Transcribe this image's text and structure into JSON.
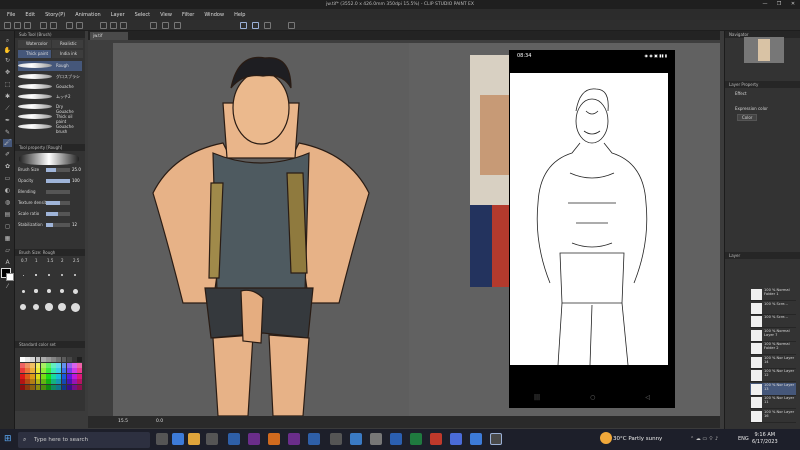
{
  "window": {
    "title": "jw.tif* (3552.0 x 426.0mm 350dpi 15.5%) - CLIP STUDIO PAINT EX",
    "minimize": "—",
    "maximize": "❐",
    "close": "✕"
  },
  "menu": [
    "File",
    "Edit",
    "Story(P)",
    "Animation",
    "Layer",
    "Select",
    "View",
    "Filter",
    "Window",
    "Help"
  ],
  "document_tab": "jw.tif",
  "subtool_panel": {
    "title": "Sub Tool (Brush)",
    "tabs": [
      "Watercolor",
      "Realistic",
      "Thick paint",
      "India ink"
    ],
    "brushes": [
      "Rough",
      "グロスブラシ",
      "Gouache",
      "ムッチ2",
      "Dry Gouache",
      "Thick oil paint",
      "Gouache brush"
    ]
  },
  "tool_property": {
    "title": "Tool property [Rough]",
    "rows": [
      {
        "label": "Brush Size",
        "value": "25.0",
        "fill": 0.4
      },
      {
        "label": "Opacity",
        "value": "100",
        "fill": 1.0
      },
      {
        "label": "Blending",
        "value": "",
        "fill": 0.0
      },
      {
        "label": "Texture density",
        "value": "",
        "fill": 0.6
      },
      {
        "label": "Scale ratio",
        "value": "",
        "fill": 0.5
      },
      {
        "label": "Stabilization",
        "value": "12",
        "fill": 0.3
      }
    ]
  },
  "brush_size_panel": {
    "title": "Brush Size: Rough",
    "labels": [
      "0.7",
      "1",
      "1.5",
      "2",
      "2.5"
    ]
  },
  "color_panel": {
    "title": "Standard color set"
  },
  "canvas_status": {
    "zoom": "15.5",
    "angle": "0.0"
  },
  "phone": {
    "time": "08:34",
    "status_icons": "◉ ◉ ▣  ▮▮ ▮"
  },
  "right_panels": {
    "navigator": "Navigator",
    "layer_property": "Layer Property",
    "effect": "Effect",
    "expression_color": "Expression color",
    "expression_value": "Color",
    "layer_title": "Layer"
  },
  "layers": [
    {
      "name": "100 % Normal Folder 1",
      "selected": false
    },
    {
      "name": "100 % Scre...",
      "selected": false
    },
    {
      "name": "100 % Scre...",
      "selected": false
    },
    {
      "name": "100 % Normal Layer 7",
      "selected": false
    },
    {
      "name": "100 % Normal Folder 2",
      "selected": false
    },
    {
      "name": "100 % Nor Layer 14",
      "selected": false
    },
    {
      "name": "100 % Nor Layer 12",
      "selected": false
    },
    {
      "name": "100 % Nor Layer 13",
      "selected": true
    },
    {
      "name": "100 % Nor Layer 11",
      "selected": false
    },
    {
      "name": "100 % Nor Layer 16",
      "selected": false
    }
  ],
  "taskbar": {
    "search_placeholder": "Type here to search",
    "weather": "30°C  Partly sunny",
    "lang": "ENG",
    "time": "9:16 AM",
    "date": "6/17/2023"
  },
  "colors": {
    "accent": "#45577a",
    "skin": "#e9b58a",
    "shirt": "#4e5a60"
  }
}
